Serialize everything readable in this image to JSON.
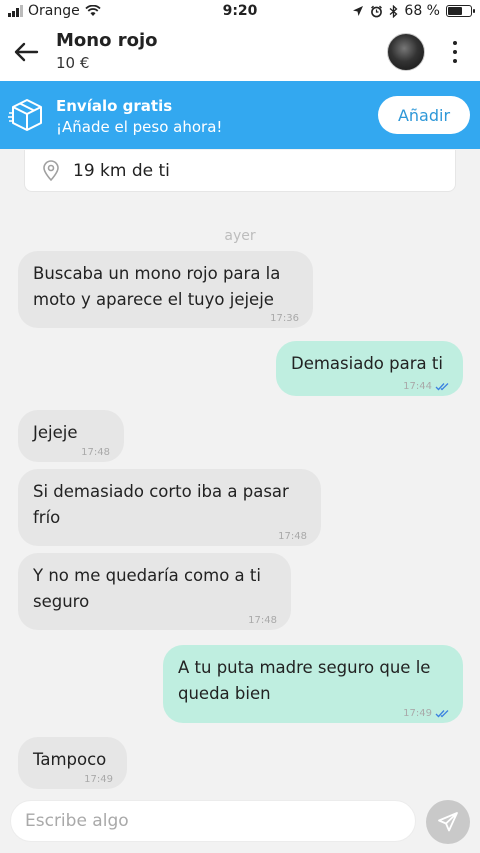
{
  "status_bar": {
    "carrier": "Orange",
    "time": "9:20",
    "battery_text": "68 %",
    "battery_level": 0.68
  },
  "header": {
    "title": "Mono rojo",
    "price": "10 €",
    "back_icon": "arrow-left-icon",
    "more_icon": "more-vertical-icon"
  },
  "promo": {
    "title": "Envíalo gratis",
    "subtitle": "¡Añade el peso ahora!",
    "button": "Añadir",
    "icon": "package-icon",
    "color": "#33a8f0"
  },
  "location": {
    "distance": "19 km de ti",
    "icon": "location-pin-icon"
  },
  "day_divider": "ayer",
  "messages": [
    {
      "direction": "in",
      "line1": "Buscaba un mono rojo para la",
      "line2": "moto y aparece el tuyo jejeje",
      "time": "17:36"
    },
    {
      "direction": "out",
      "line1": "Demasiado para ti",
      "time": "17:44",
      "read": true
    },
    {
      "direction": "in",
      "line1": "Jejeje",
      "time": "17:48"
    },
    {
      "direction": "in",
      "line1": "Si demasiado corto iba a pasar",
      "line2": "frío",
      "time": "17:48"
    },
    {
      "direction": "in",
      "line1": "Y no me quedaría como a ti",
      "line2": "seguro",
      "time": "17:48"
    },
    {
      "direction": "out",
      "line1": "A tu puta madre seguro que le",
      "line2": "queda bien",
      "time": "17:49",
      "read": true
    },
    {
      "direction": "in",
      "line1": "Tampoco",
      "time": "17:49"
    }
  ],
  "composer": {
    "placeholder": "Escribe algo",
    "send_icon": "send-icon"
  },
  "colors": {
    "incoming_bubble": "#e6e6e6",
    "outgoing_bubble": "#bfeee0",
    "read_ticks": "#3b82e0"
  }
}
